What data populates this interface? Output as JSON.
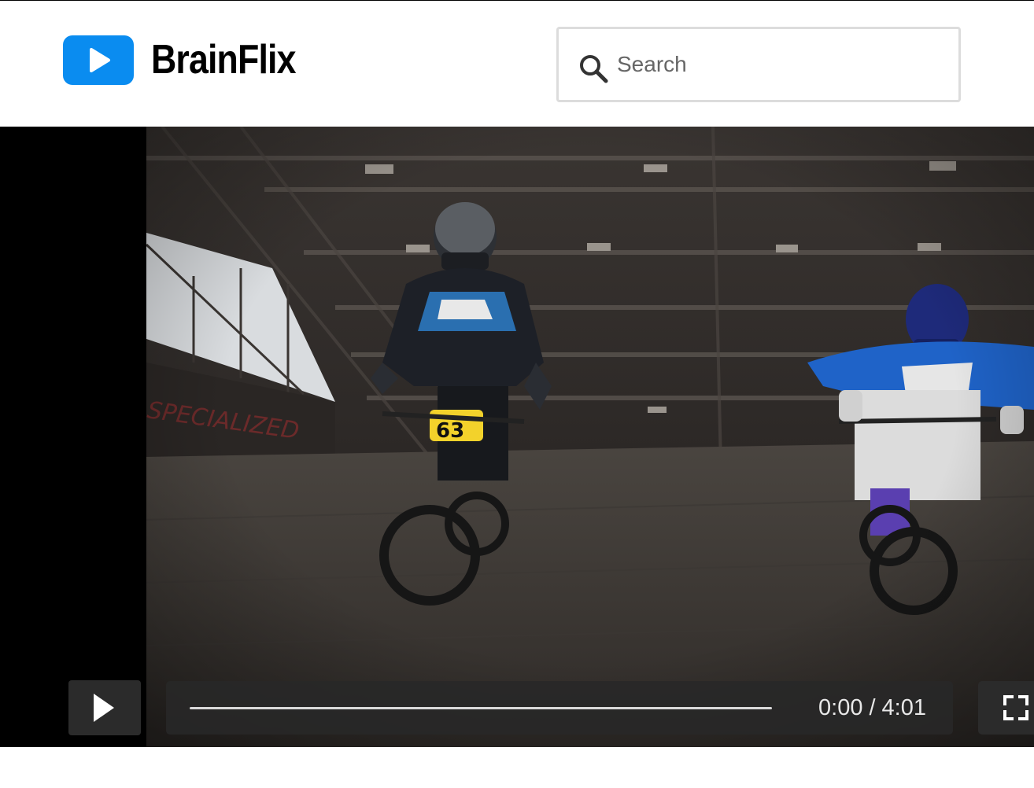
{
  "header": {
    "brand_name": "BrainFlix",
    "logo_icon": "play-button-logo-icon",
    "brand_color": "#0a8cf0"
  },
  "search": {
    "placeholder": "Search",
    "value": "",
    "icon": "search-icon"
  },
  "player": {
    "video_description_icon": "video-frame",
    "play_icon": "play-icon",
    "fullscreen_icon": "fullscreen-icon",
    "current_time": "0:00",
    "separator": "/",
    "duration": "4:01",
    "progress_fraction": 0
  }
}
